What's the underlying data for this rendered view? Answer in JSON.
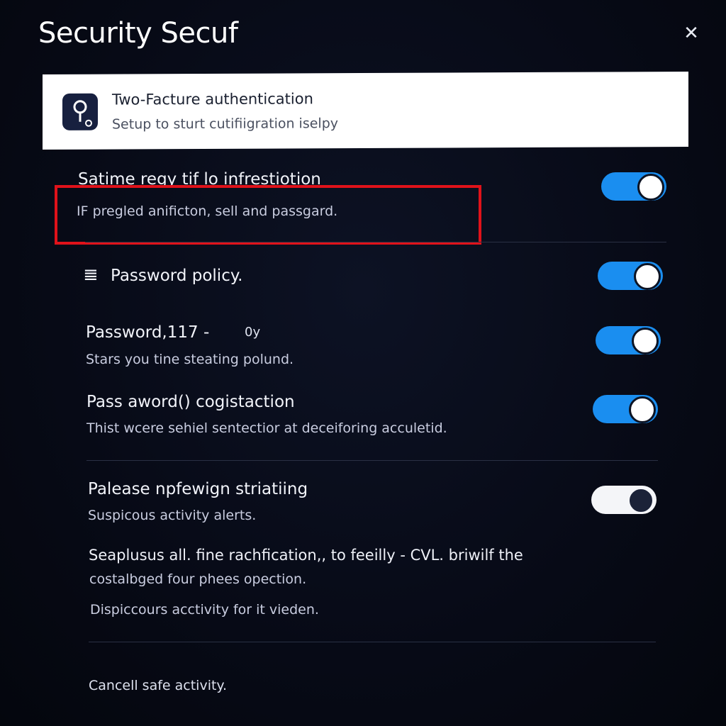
{
  "header": {
    "title": "Security Secuf",
    "close_icon": "close-icon"
  },
  "two_factor_card": {
    "title": "Two-Facture authentication",
    "subtitle": "Setup to sturt cutifiigration iselpy",
    "icon": "key-icon"
  },
  "settings": [
    {
      "title": "Satime regy tif lo infrestiotion",
      "subtitle": "IF pregled anificton, sell and passgard.",
      "toggle_on": true,
      "highlighted": true,
      "highlight_color": "#e0121a"
    },
    {
      "title": "Password policy.",
      "icon_glyph": "𝌆",
      "toggle_on": true
    },
    {
      "title": "Password,117 -",
      "title_suffix": "0y",
      "subtitle": "Stars you tine steating polund.",
      "toggle_on": true
    },
    {
      "title": "Pass aword() cogistaction",
      "subtitle": "Thist wcere sehiel sentectior at deceiforing acculetid.",
      "toggle_on": true
    },
    {
      "title": "Palease npfewign striatiing",
      "subtitle": "Suspicous activity alerts.",
      "toggle_on": false
    }
  ],
  "info_block": {
    "line1": "Seaplusus all. fine rachfication,, to feeilly - CVL. briwilf the",
    "line2": "costalbged four phees opection.",
    "line3": "Dispiccours acctivity for it vieden."
  },
  "footer": {
    "link": "Cancell safe activity."
  },
  "colors": {
    "toggle_on": "#1a8ef0",
    "background": "#070a16",
    "highlight": "#e0121a"
  }
}
